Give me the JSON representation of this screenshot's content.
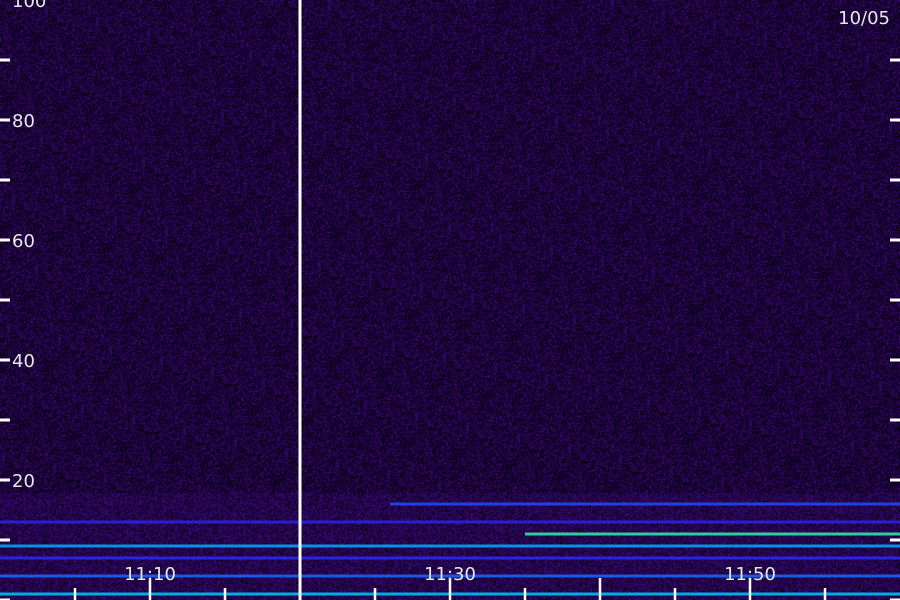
{
  "chart_data": {
    "type": "heatmap",
    "title": "",
    "xlabel": "",
    "ylabel": "",
    "date_label": "10/05",
    "x_range": [
      "11:00",
      "12:00"
    ],
    "x_tick_labels": [
      "11:10",
      "11:30",
      "11:50"
    ],
    "ylim": [
      0,
      100
    ],
    "y_tick_labels": [
      20,
      40,
      60,
      80,
      100
    ],
    "colormap": [
      "#14002a",
      "#3a0a7a",
      "#2a2aff",
      "#00c8ff",
      "#33ff99"
    ],
    "data_gap_at": "11:20",
    "bands": [
      {
        "y": 16,
        "start": "11:26",
        "end": "12:00",
        "intensity": 0.55
      },
      {
        "y": 13,
        "start": "11:00",
        "end": "12:00",
        "intensity": 0.45
      },
      {
        "y": 11,
        "start": "11:35",
        "end": "12:00",
        "intensity": 0.95
      },
      {
        "y": 9,
        "start": "11:00",
        "end": "12:00",
        "intensity": 0.7
      },
      {
        "y": 7,
        "start": "11:00",
        "end": "12:00",
        "intensity": 0.5
      },
      {
        "y": 4,
        "start": "11:00",
        "end": "12:00",
        "intensity": 0.6
      },
      {
        "y": 1,
        "start": "11:00",
        "end": "12:00",
        "intensity": 0.75
      }
    ],
    "colors": {
      "background": "#14002a",
      "noise": "#3a0a7a",
      "axis": "#ffffff",
      "separator": "#ffffff"
    }
  }
}
